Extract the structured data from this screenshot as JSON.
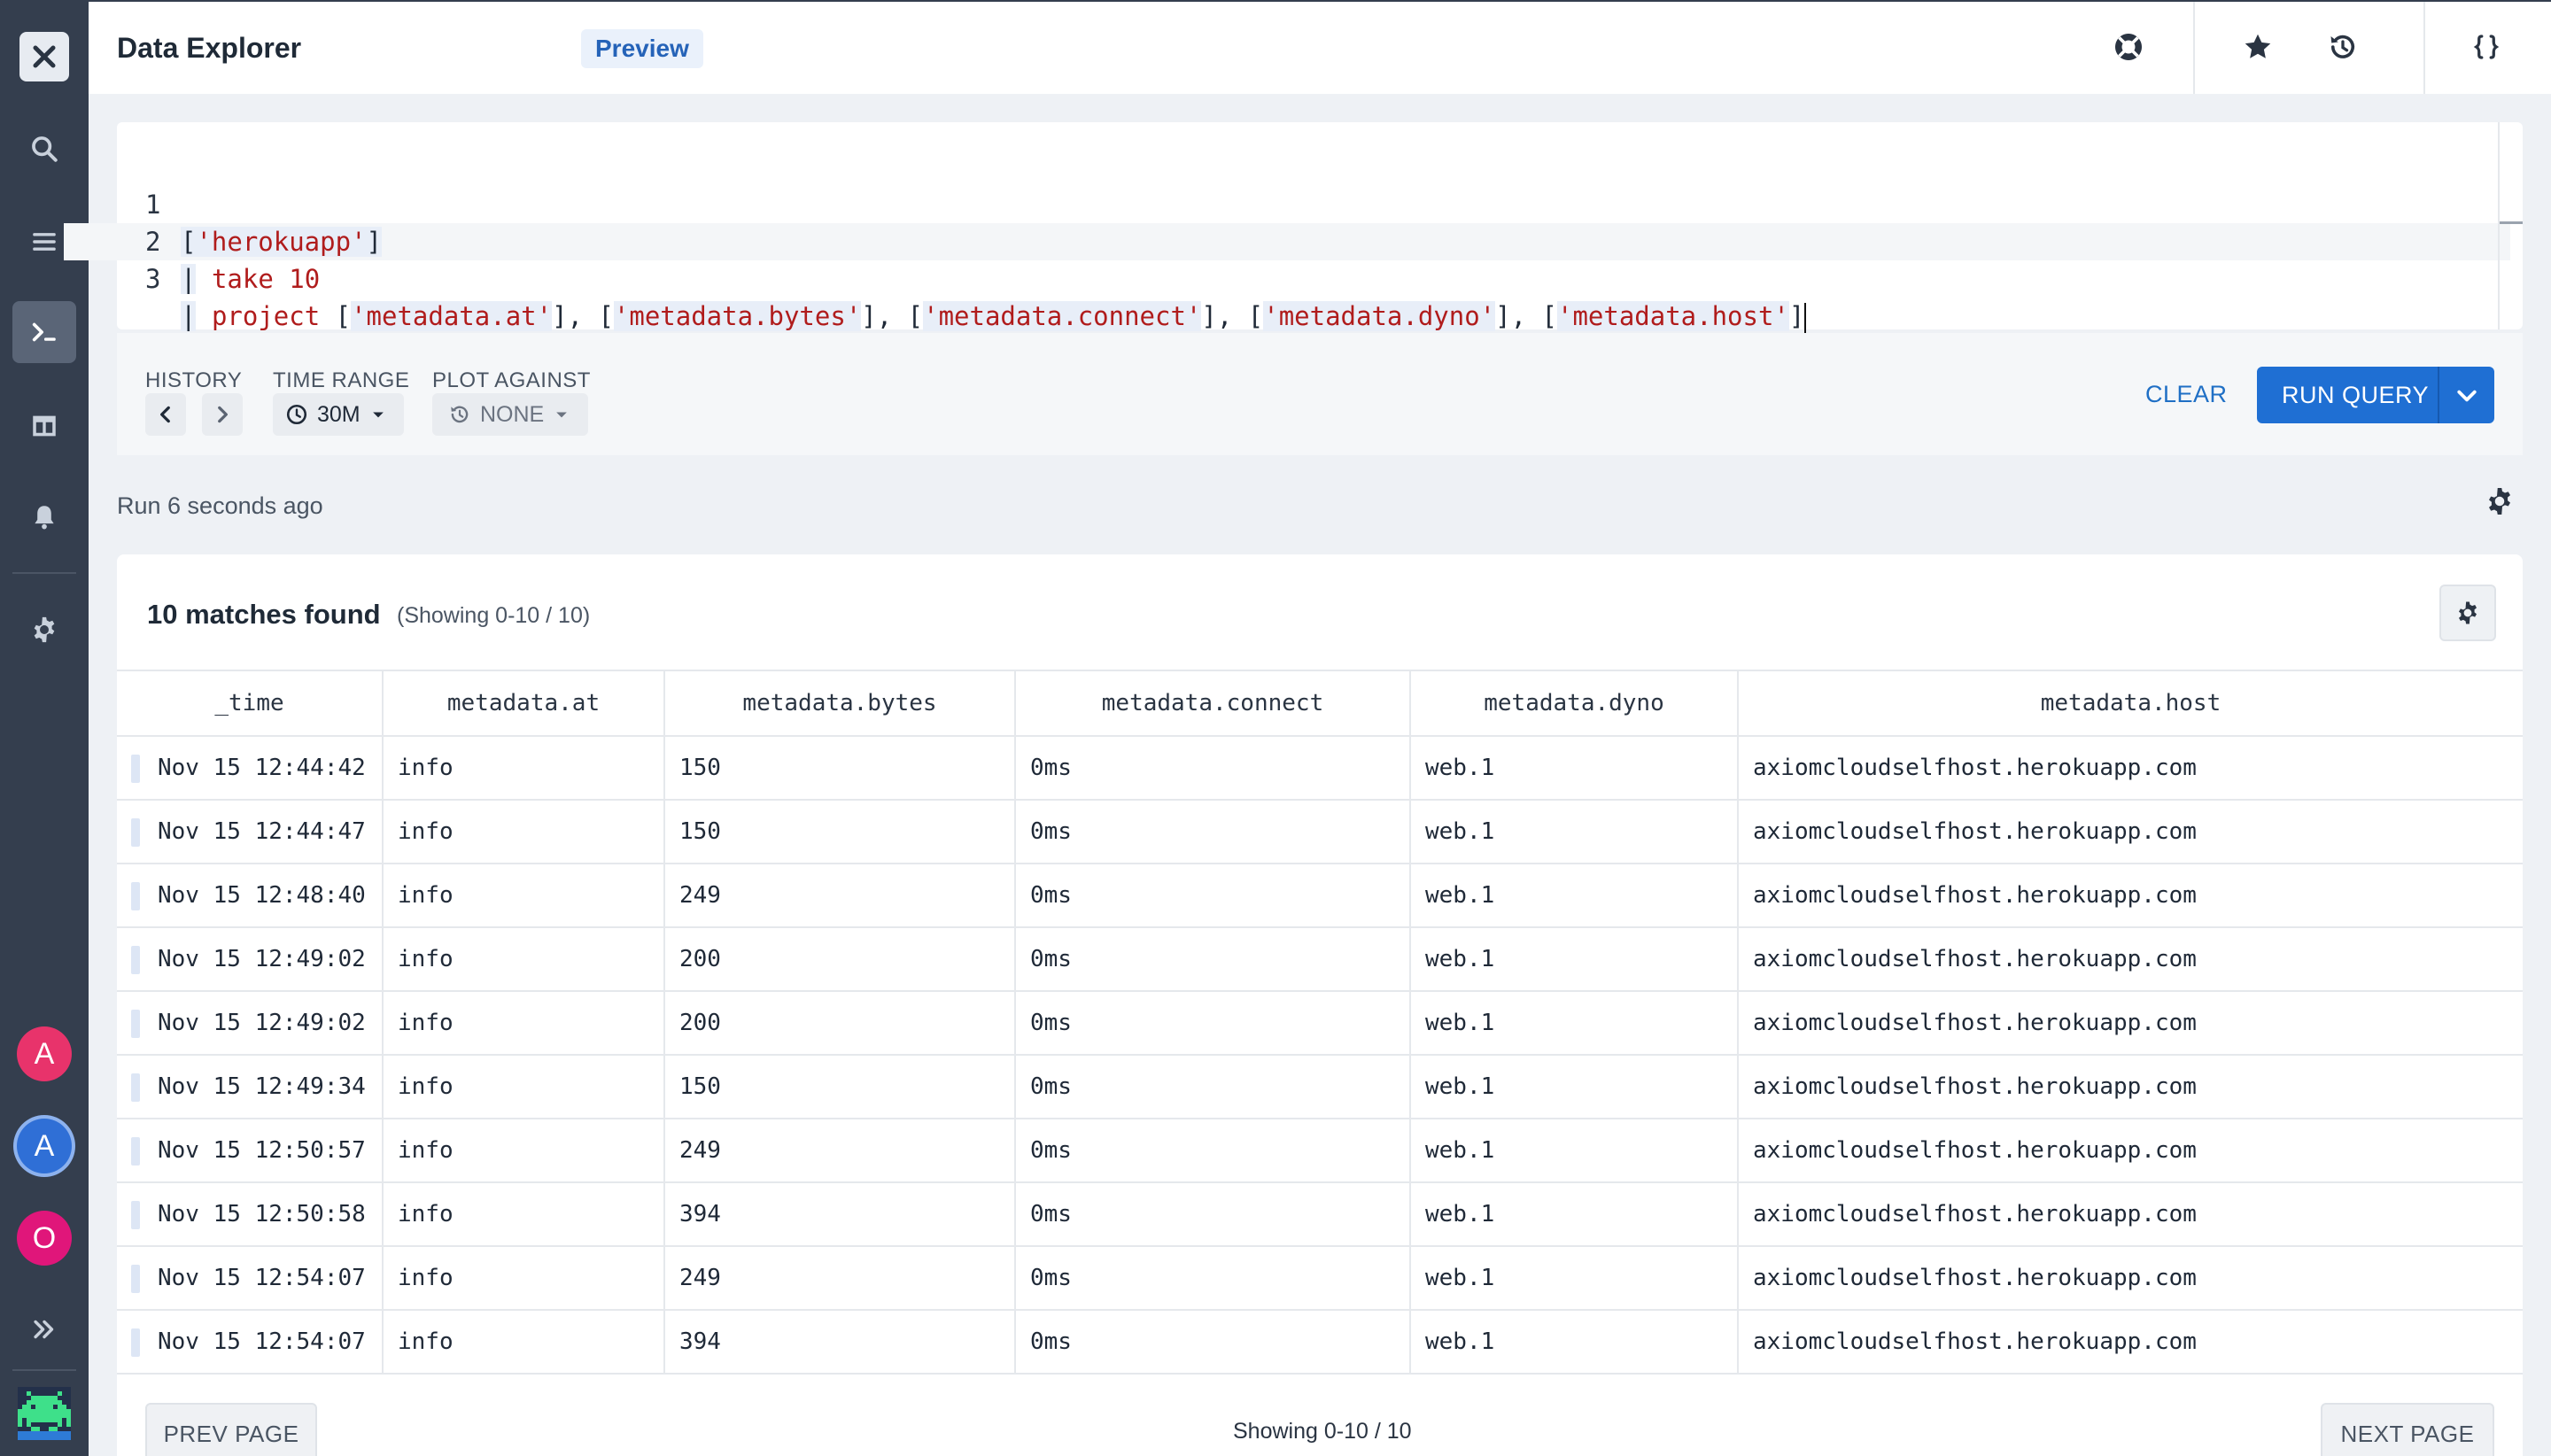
{
  "header": {
    "title": "Data Explorer",
    "badge": "Preview"
  },
  "sidebar": {
    "items": [
      {
        "icon": "close-logo-icon"
      },
      {
        "icon": "search-icon"
      },
      {
        "icon": "list-icon"
      },
      {
        "icon": "terminal-icon",
        "active": true
      },
      {
        "icon": "dashboard-icon"
      },
      {
        "icon": "bell-icon"
      },
      {
        "icon": "gear-icon"
      }
    ],
    "avatars": [
      "A",
      "A",
      "O"
    ],
    "expand_icon": "double-chevron-right-icon",
    "app_icon": "space-invader-icon"
  },
  "editor": {
    "lines": [
      {
        "number": "1"
      },
      {
        "number": "2"
      },
      {
        "number": "3"
      }
    ],
    "dataset": "'herokuapp'",
    "take_keyword": "take",
    "take_value": "10",
    "project_keyword": "project",
    "fields": [
      "'metadata.at'",
      "'metadata.bytes'",
      "'metadata.connect'",
      "'metadata.dyno'",
      "'metadata.host'"
    ]
  },
  "toolbar": {
    "history_label": "HISTORY",
    "time_range_label": "TIME RANGE",
    "time_range_value": "30M",
    "plot_against_label": "PLOT AGAINST",
    "plot_against_value": "NONE",
    "clear_label": "CLEAR",
    "run_label": "RUN QUERY"
  },
  "run_status": "Run 6 seconds ago",
  "results": {
    "matches": "10 matches found",
    "showing": "(Showing 0-10 / 10)",
    "columns": [
      "_time",
      "metadata.at",
      "metadata.bytes",
      "metadata.connect",
      "metadata.dyno",
      "metadata.host"
    ],
    "rows": [
      [
        "Nov 15 12:44:42",
        "info",
        "150",
        "0ms",
        "web.1",
        "axiomcloudselfhost.herokuapp.com"
      ],
      [
        "Nov 15 12:44:47",
        "info",
        "150",
        "0ms",
        "web.1",
        "axiomcloudselfhost.herokuapp.com"
      ],
      [
        "Nov 15 12:48:40",
        "info",
        "249",
        "0ms",
        "web.1",
        "axiomcloudselfhost.herokuapp.com"
      ],
      [
        "Nov 15 12:49:02",
        "info",
        "200",
        "0ms",
        "web.1",
        "axiomcloudselfhost.herokuapp.com"
      ],
      [
        "Nov 15 12:49:02",
        "info",
        "200",
        "0ms",
        "web.1",
        "axiomcloudselfhost.herokuapp.com"
      ],
      [
        "Nov 15 12:49:34",
        "info",
        "150",
        "0ms",
        "web.1",
        "axiomcloudselfhost.herokuapp.com"
      ],
      [
        "Nov 15 12:50:57",
        "info",
        "249",
        "0ms",
        "web.1",
        "axiomcloudselfhost.herokuapp.com"
      ],
      [
        "Nov 15 12:50:58",
        "info",
        "394",
        "0ms",
        "web.1",
        "axiomcloudselfhost.herokuapp.com"
      ],
      [
        "Nov 15 12:54:07",
        "info",
        "249",
        "0ms",
        "web.1",
        "axiomcloudselfhost.herokuapp.com"
      ],
      [
        "Nov 15 12:54:07",
        "info",
        "394",
        "0ms",
        "web.1",
        "axiomcloudselfhost.herokuapp.com"
      ]
    ]
  },
  "pager": {
    "prev": "PREV PAGE",
    "next": "NEXT PAGE",
    "status": "Showing 0-10 / 10"
  },
  "colors": {
    "sidebar_bg": "#343e4e",
    "accent": "#1f6fd3",
    "string": "#b01c1c"
  }
}
